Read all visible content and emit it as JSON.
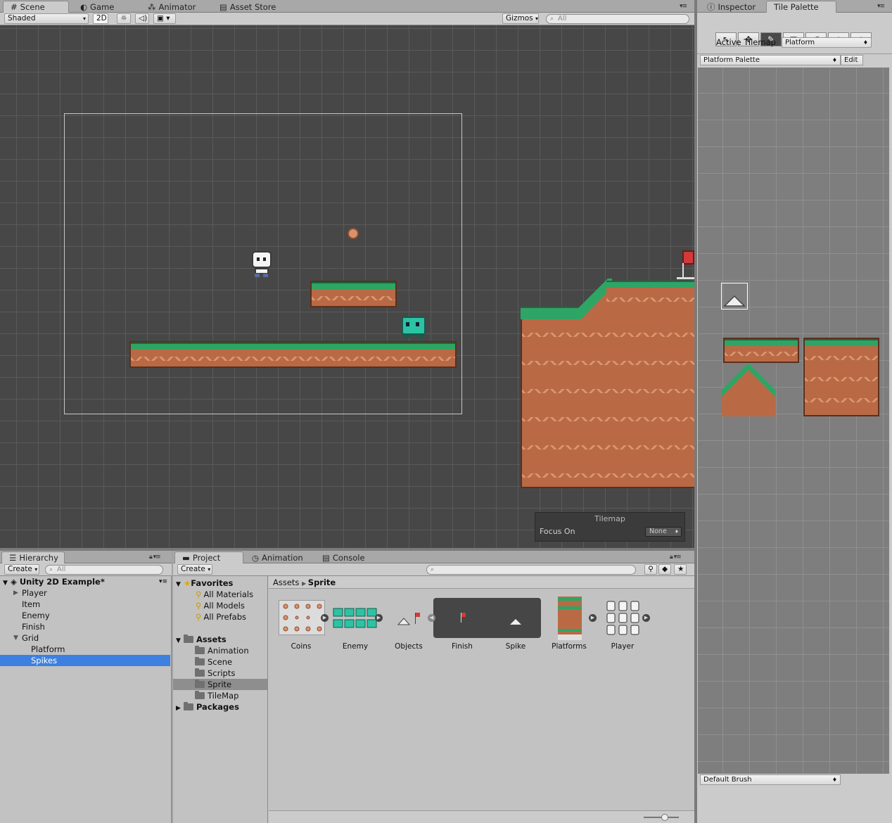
{
  "scene_tabs": {
    "scene": "Scene",
    "game": "Game",
    "animator": "Animator",
    "asset_store": "Asset Store"
  },
  "scene_toolbar": {
    "shading": "Shaded",
    "mode_2d": "2D",
    "gizmos": "Gizmos",
    "search_placeholder": "All"
  },
  "tilemap_overlay": {
    "title": "Tilemap",
    "focus_label": "Focus On",
    "focus_value": "None"
  },
  "right_tabs": {
    "inspector": "Inspector",
    "tile_palette": "Tile Palette"
  },
  "tile_palette": {
    "tools": [
      "select-tool-icon",
      "move-tool-icon",
      "paint-brush-icon",
      "box-fill-icon",
      "picker-icon",
      "eraser-icon",
      "fill-icon"
    ],
    "active_tilemap_label": "Active Tilemap",
    "active_tilemap_value": "Platform",
    "palette_name": "Platform Palette",
    "edit_label": "Edit",
    "brush": "Default Brush"
  },
  "hierarchy": {
    "tab": "Hierarchy",
    "create": "Create",
    "search_placeholder": "All",
    "scene_name": "Unity 2D Example*",
    "items": [
      {
        "label": "Player",
        "indent": 1,
        "expander": "▶"
      },
      {
        "label": "Item",
        "indent": 1,
        "expander": ""
      },
      {
        "label": "Enemy",
        "indent": 1,
        "expander": ""
      },
      {
        "label": "Finish",
        "indent": 1,
        "expander": ""
      },
      {
        "label": "Grid",
        "indent": 1,
        "expander": "▼"
      },
      {
        "label": "Platform",
        "indent": 2,
        "expander": ""
      },
      {
        "label": "Spikes",
        "indent": 2,
        "expander": "",
        "selected": true
      }
    ]
  },
  "project_tabs": {
    "project": "Project",
    "animation": "Animation",
    "console": "Console"
  },
  "project": {
    "create": "Create",
    "favorites": {
      "label": "Favorites",
      "items": [
        "All Materials",
        "All Models",
        "All Prefabs"
      ]
    },
    "assets": {
      "label": "Assets",
      "items": [
        "Animation",
        "Scene",
        "Scripts",
        "Sprite",
        "TileMap"
      ],
      "selected": "Sprite"
    },
    "packages": "Packages",
    "breadcrumb": {
      "root": "Assets",
      "current": "Sprite"
    },
    "asset_items": [
      "Coins",
      "Enemy",
      "Objects",
      "Finish",
      "Spike",
      "Platforms",
      "Player"
    ]
  },
  "colors": {
    "grass": "#2ea565",
    "dirt": "#b96a45",
    "selection": "#3d80df",
    "scene_bg": "#474747"
  }
}
